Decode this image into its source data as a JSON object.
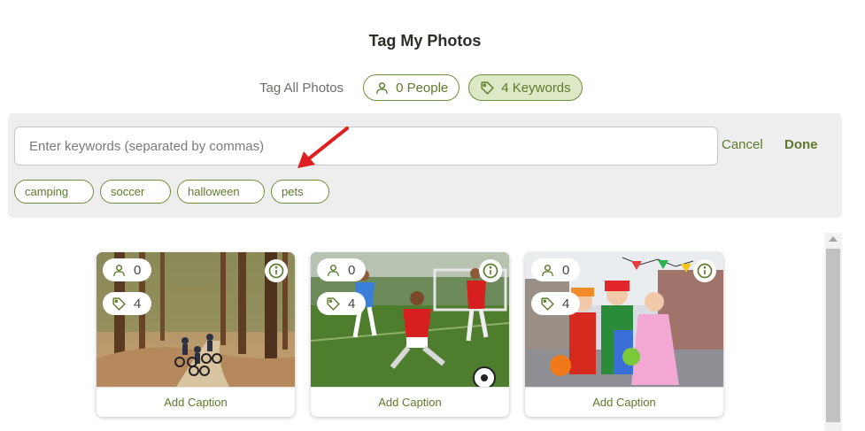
{
  "page": {
    "title": "Tag My Photos"
  },
  "tagbar": {
    "tag_all": "Tag All Photos",
    "people_label": "0 People",
    "keywords_label": "4 Keywords"
  },
  "keyword_panel": {
    "placeholder": "Enter keywords (separated by commas)",
    "cancel": "Cancel",
    "done": "Done",
    "keywords": [
      "camping",
      "soccer",
      "halloween",
      "pets"
    ]
  },
  "photos": [
    {
      "people": "0",
      "keywords": "4",
      "caption": "Add Caption"
    },
    {
      "people": "0",
      "keywords": "4",
      "caption": "Add Caption"
    },
    {
      "people": "0",
      "keywords": "4",
      "caption": "Add Caption"
    }
  ],
  "colors": {
    "accent": "#5d7a2b",
    "accent_border": "#6e8f3a",
    "active_fill": "#dce8c6",
    "panel": "#eeeeee",
    "annotation_arrow": "#e02020"
  },
  "icons": {
    "people": "person-icon",
    "keywords": "tag-icon",
    "info": "info-icon"
  }
}
